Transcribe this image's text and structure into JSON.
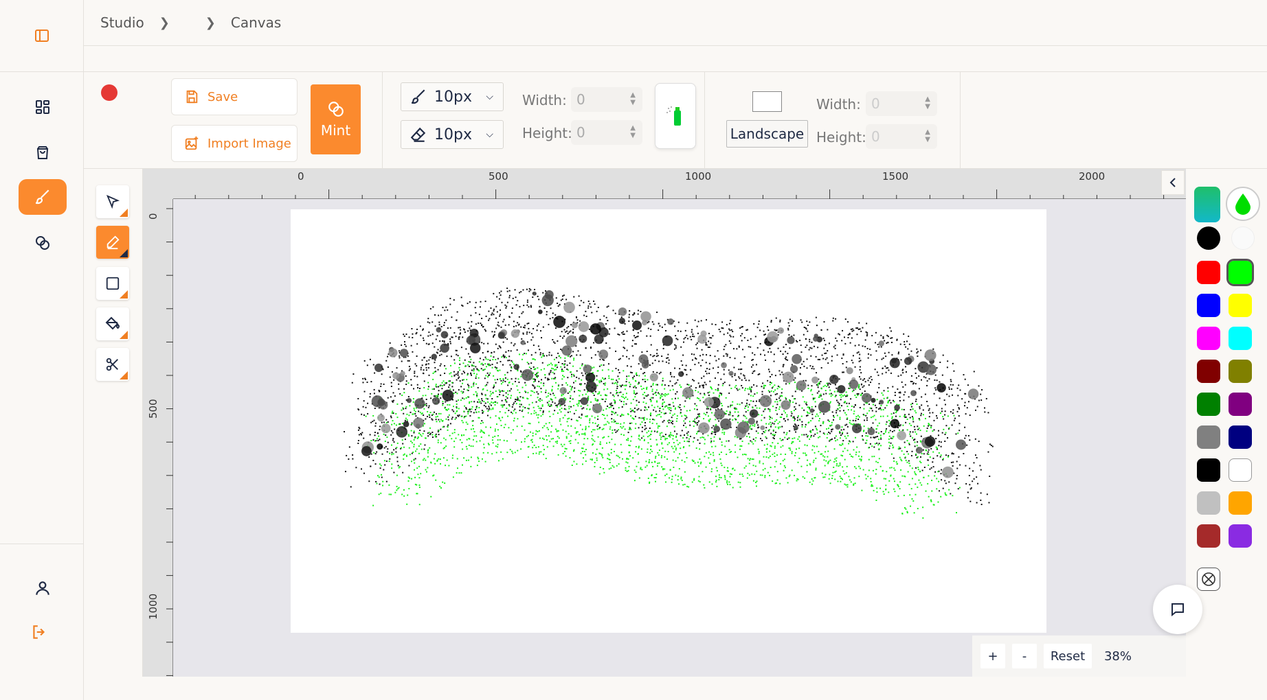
{
  "breadcrumb": {
    "root": "Studio",
    "current": "Canvas"
  },
  "toolbar": {
    "save_label": "Save",
    "import_label": "Import Image",
    "mint_label": "Mint",
    "brush_size": "10px",
    "eraser_size": "10px",
    "width_label": "Width:",
    "height_label": "Height:",
    "width_value": "0",
    "height_value": "0",
    "canvas_width_label": "Width:",
    "canvas_height_label": "Height:",
    "canvas_width_placeholder": "0",
    "canvas_height_placeholder": "0",
    "orientation_label": "Landscape"
  },
  "rulers": {
    "top_ticks": [
      "0",
      "500",
      "1000",
      "1500",
      "2000"
    ],
    "left_ticks": [
      "0",
      "500",
      "1000"
    ]
  },
  "zoom": {
    "plus": "+",
    "minus": "-",
    "reset": "Reset",
    "level": "38%"
  },
  "colors": {
    "accent": "#fb8a2e",
    "selected_gradient": [
      "#1fbf6a",
      "#12b8c9"
    ],
    "selected_color": "#00dd00",
    "palette": [
      "#ff0000",
      "#00ff00",
      "#0000ff",
      "#ffff00",
      "#ff00ff",
      "#00ffff",
      "#800000",
      "#808000",
      "#008000",
      "#800080",
      "#808080",
      "#000080",
      "#000000",
      "#ffffff",
      "#c0c0c0",
      "#ffa500",
      "#a52a2a",
      "#8a2be2"
    ]
  },
  "nav_icons": [
    "sidebar-toggle-icon",
    "dashboard-icon",
    "bag-icon",
    "brush-icon",
    "coins-icon",
    "user-icon",
    "logout-icon"
  ]
}
